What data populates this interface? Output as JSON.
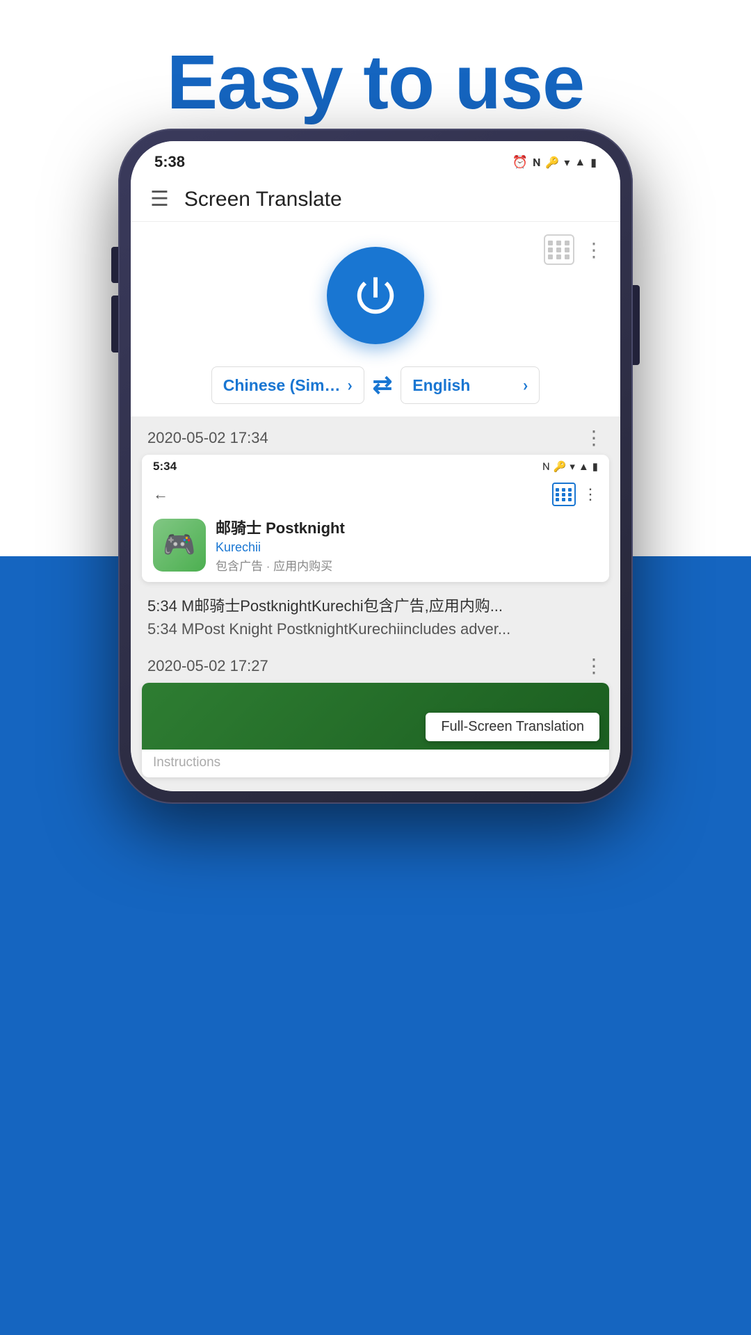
{
  "page": {
    "title": "Easy to use",
    "bg_top": "#ffffff",
    "bg_bottom": "#1565C0"
  },
  "status_bar": {
    "time": "5:38",
    "icons_right": [
      "alarm",
      "nfc",
      "key",
      "wifi",
      "signal",
      "battery"
    ]
  },
  "app_bar": {
    "title": "Screen Translate",
    "menu_label": "☰"
  },
  "power_button": {
    "label": "Power",
    "aria": "Toggle translation"
  },
  "language_selector": {
    "source_lang": "Chinese (Simpli...",
    "target_lang": "English",
    "swap_label": "⇄"
  },
  "history": [
    {
      "date": "2020-05-02 17:34",
      "screenshot_status_time": "5:34",
      "app_name": "邮骑士 Postknight",
      "app_dev": "Kurechii",
      "app_sub": "包含广告 · 应用内购买",
      "orig_text": "5:34 M邮骑士PostknightKurechi包含广告,应用内购...",
      "trans_text": "5:34 MPost Knight PostknightKurechiincludes adver..."
    },
    {
      "date": "2020-05-02 17:27",
      "fullscreen_badge": "Full-Screen Translation",
      "instructions_label": "Instructions"
    }
  ],
  "icons": {
    "menu": "☰",
    "power": "⏻",
    "chevron_right": "›",
    "three_dots": "⋮",
    "swap": "⇄",
    "back_arrow": "←",
    "alarm": "⏰",
    "nfc": "N",
    "key": "🔑",
    "wifi": "▼",
    "signal": "▲",
    "battery": "▮"
  }
}
